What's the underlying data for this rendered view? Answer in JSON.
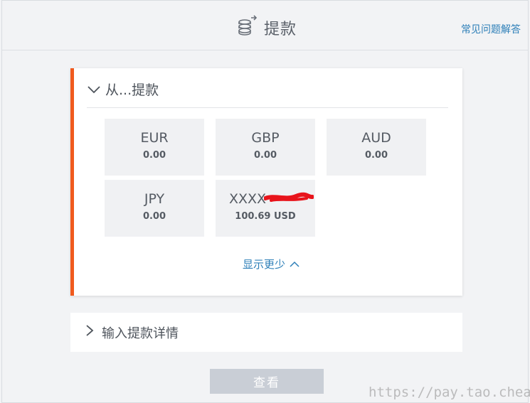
{
  "header": {
    "title": "提款",
    "faq_label": "常见问题解答"
  },
  "withdraw_from": {
    "title": "从...提款",
    "currencies": [
      {
        "code": "EUR",
        "amount": "0.00"
      },
      {
        "code": "GBP",
        "amount": "0.00"
      },
      {
        "code": "AUD",
        "amount": "0.00"
      },
      {
        "code": "JPY",
        "amount": "0.00"
      },
      {
        "code": "XXXX",
        "amount": "100.69 USD"
      }
    ],
    "show_less_label": "显示更少"
  },
  "details": {
    "label": "输入提款详情"
  },
  "actions": {
    "view_label": "查看"
  },
  "watermark": "https://pay.tao.cheap/",
  "colors": {
    "accent": "#f05a1e",
    "link": "#2d7fb8",
    "button_disabled": "#c9ced6"
  },
  "icons": {
    "header": "coins-stack-icon",
    "expand_open": "chevron-down-icon",
    "expand_closed": "chevron-right-icon",
    "show_less": "chevron-up-icon"
  }
}
